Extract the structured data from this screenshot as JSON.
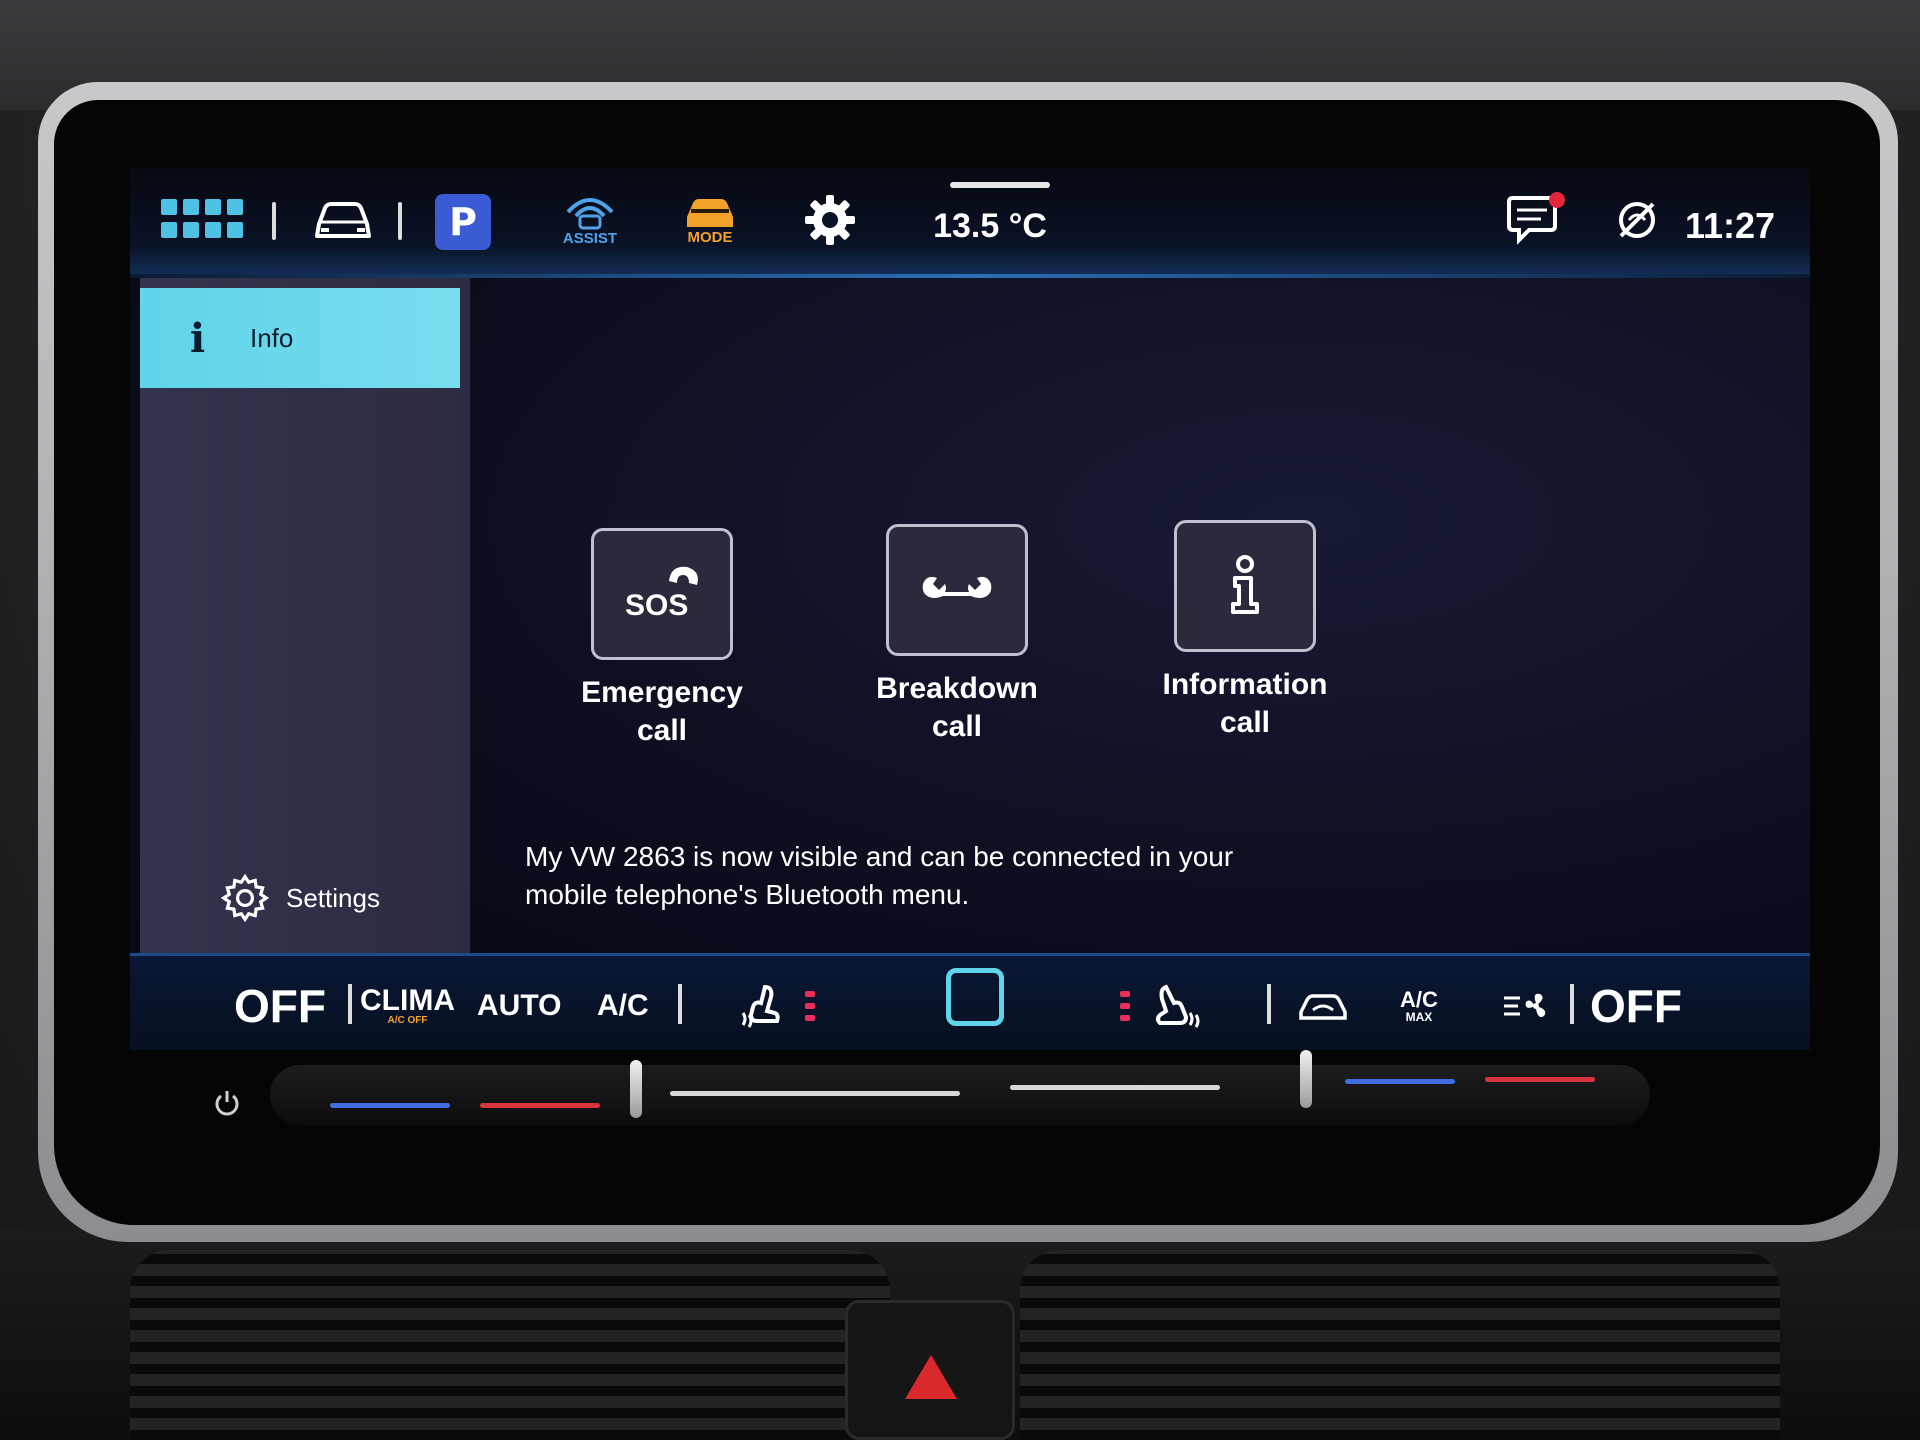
{
  "status_bar": {
    "park_label": "P",
    "assist_label": "ASSIST",
    "mode_label": "MODE",
    "temperature": "13.5 °C",
    "time": "11:27"
  },
  "sidebar": {
    "active_item": "Info",
    "settings_label": "Settings"
  },
  "tiles": [
    {
      "label_line1": "Emergency",
      "label_line2": "call",
      "glyph": "SOS"
    },
    {
      "label_line1": "Breakdown",
      "label_line2": "call"
    },
    {
      "label_line1": "Information",
      "label_line2": "call"
    }
  ],
  "message": {
    "line1": "My VW 2863 is now visible and can be connected in your",
    "line2": "mobile telephone's Bluetooth menu."
  },
  "climate": {
    "left_off": "OFF",
    "clima": "CLIMA",
    "clima_sub": "A/C OFF",
    "auto": "AUTO",
    "ac": "A/C",
    "ac_max_top": "A/C",
    "ac_max_bottom": "MAX",
    "right_off": "OFF"
  },
  "colors": {
    "accent": "#5fd4ea",
    "assist": "#4fa3e8",
    "mode": "#f2a12b",
    "notification_dot": "#e3263c",
    "heat": "#e8315a",
    "park": "#3a5bd3"
  }
}
